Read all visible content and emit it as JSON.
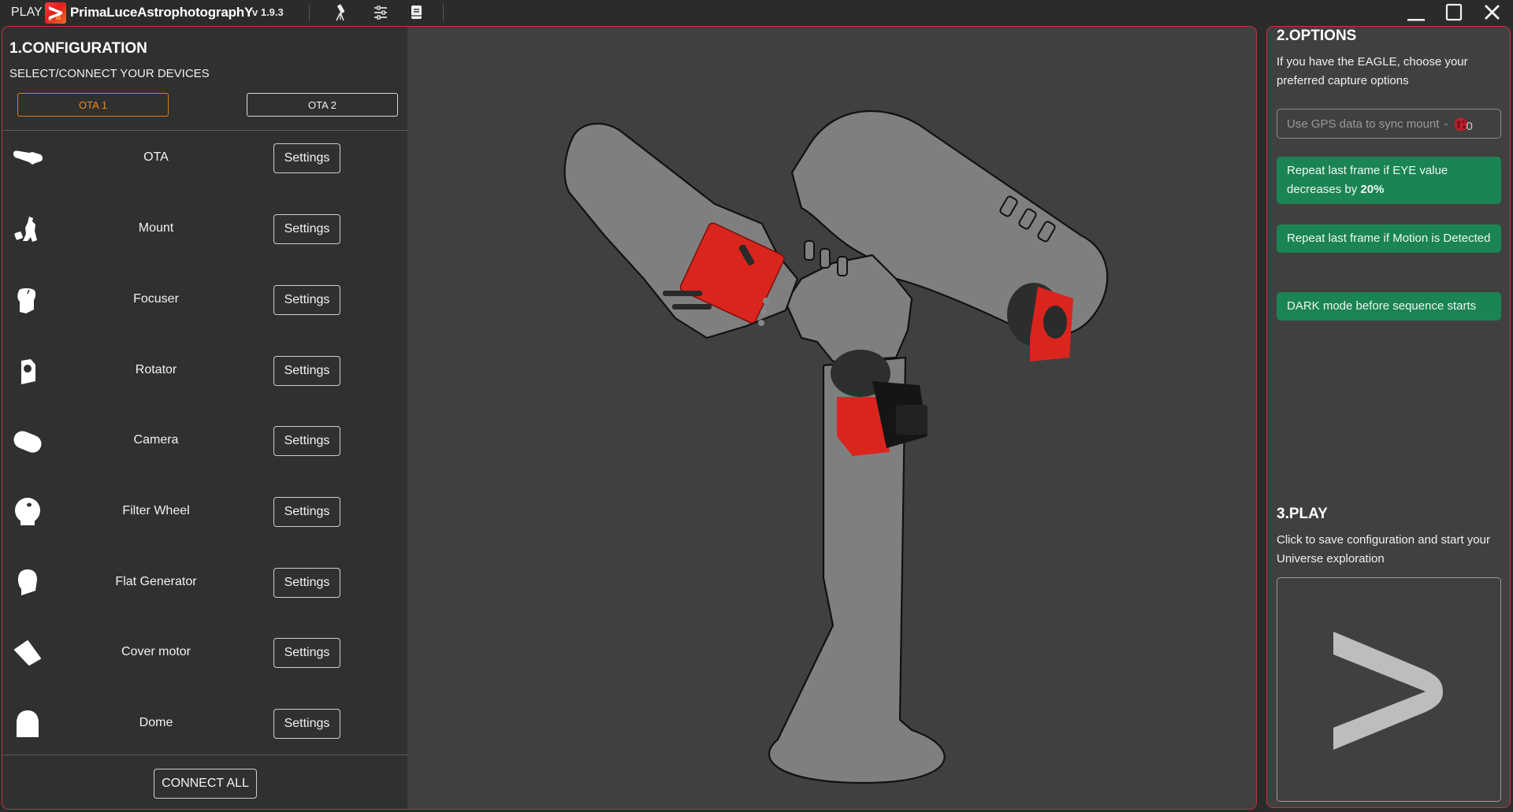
{
  "titlebar": {
    "play_label": "PLAY",
    "brand_name": "PrimaLuceAstrophotographY",
    "version": "v 1.9.3",
    "tool_icons": [
      "telescope-icon",
      "sliders-icon",
      "book-icon"
    ],
    "window_controls": [
      "minimize-icon",
      "maximize-icon",
      "close-icon"
    ]
  },
  "configuration": {
    "title": "1.CONFIGURATION",
    "subtitle": "SELECT/CONNECT YOUR DEVICES",
    "ota_tabs": [
      {
        "label": "OTA 1",
        "active": true
      },
      {
        "label": "OTA 2",
        "active": false
      }
    ],
    "devices": [
      {
        "label": "OTA",
        "icon": "ota-icon",
        "button": "Settings"
      },
      {
        "label": "Mount",
        "icon": "mount-icon",
        "button": "Settings"
      },
      {
        "label": "Focuser",
        "icon": "focuser-icon",
        "button": "Settings"
      },
      {
        "label": "Rotator",
        "icon": "rotator-icon",
        "button": "Settings"
      },
      {
        "label": "Camera",
        "icon": "camera-icon",
        "button": "Settings"
      },
      {
        "label": "Filter Wheel",
        "icon": "filter-wheel-icon",
        "button": "Settings"
      },
      {
        "label": "Flat Generator",
        "icon": "flat-generator-icon",
        "button": "Settings"
      },
      {
        "label": "Cover motor",
        "icon": "cover-motor-icon",
        "button": "Settings"
      },
      {
        "label": "Dome",
        "icon": "dome-icon",
        "button": "Settings"
      }
    ],
    "connect_all_label": "CONNECT ALL"
  },
  "options": {
    "title": "2.OPTIONS",
    "description": "If you have the EAGLE, choose your preferred capture options",
    "gps_field": {
      "label": "Use GPS data to sync mount",
      "separator": "-",
      "count": "0",
      "icon": "globe-icon"
    },
    "buttons": [
      {
        "text": "Repeat last frame if EYE value decreases by ",
        "bold": "20%"
      },
      {
        "text": "Repeat last frame if Motion is Detected",
        "bold": ""
      },
      {
        "text": "DARK mode before sequence starts",
        "bold": ""
      }
    ],
    "accent_color": "#1a8453"
  },
  "play": {
    "title": "3.PLAY",
    "description": "Click to save configuration and start your Universe exploration",
    "button_icon": "play-chevron-icon"
  },
  "colors": {
    "frame_border": "#c5313e",
    "active_tab": "#e07d0f",
    "device_red": "#d9251d"
  }
}
